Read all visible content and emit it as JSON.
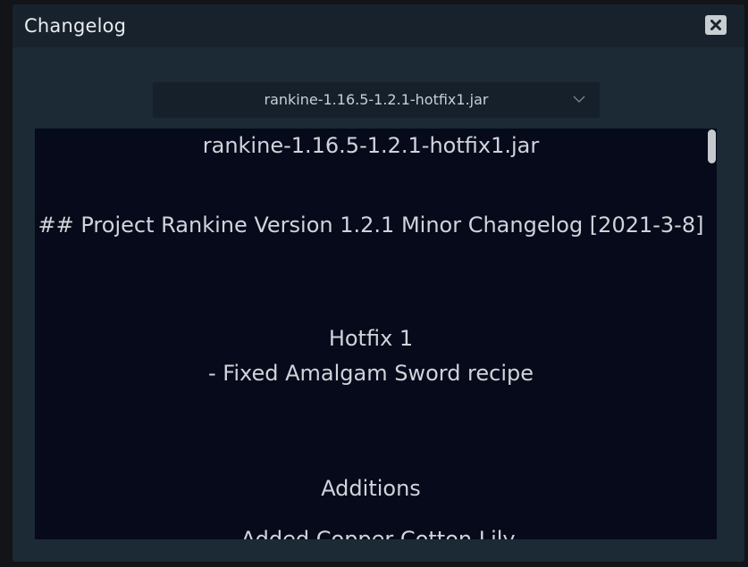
{
  "dialog": {
    "title": "Changelog",
    "close_icon": "close-icon"
  },
  "file_select": {
    "selected": "rankine-1.16.5-1.2.1-hotfix1.jar",
    "icon": "chevron-down-icon"
  },
  "changelog": {
    "lines": [
      "rankine-1.16.5-1.2.1-hotfix1.jar",
      "## Project Rankine Version 1.2.1 Minor Changelog [2021-3-8]",
      "Hotfix 1",
      "- Fixed Amalgam Sword recipe",
      "Additions",
      "- Added Copper Cotton Lily"
    ]
  },
  "colors": {
    "dialog_bg": "#1b2a35",
    "titlebar_bg": "#17222c",
    "content_bg": "#060a1a",
    "text": "#cfd4db"
  }
}
